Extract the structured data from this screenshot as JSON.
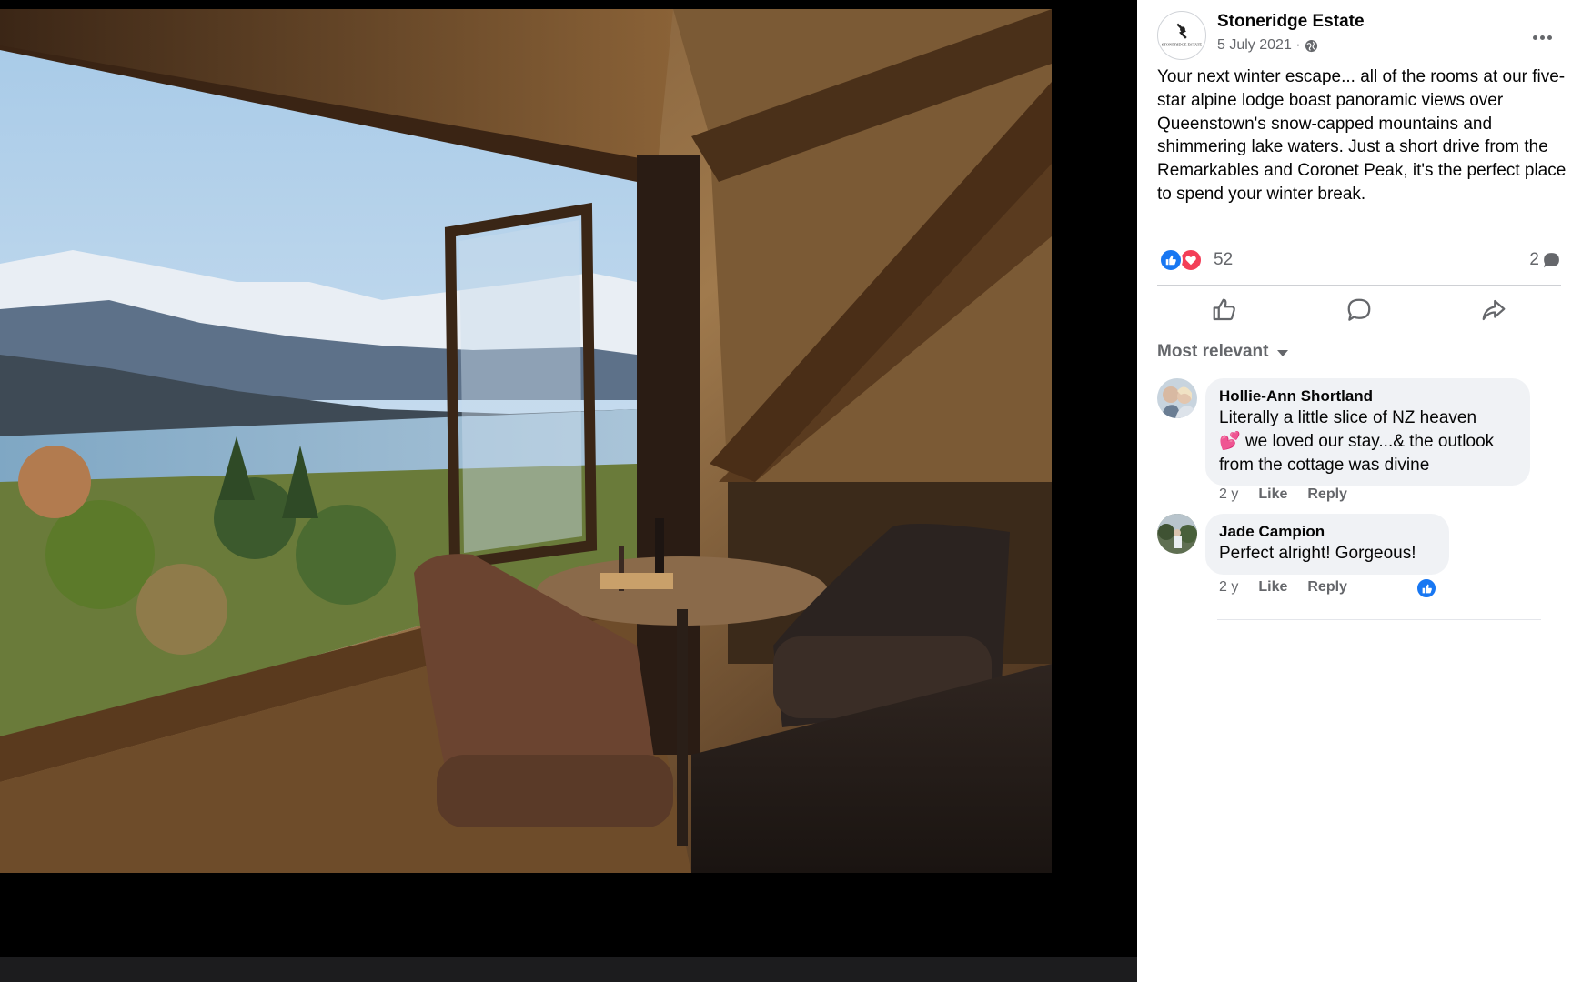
{
  "post": {
    "page_name": "Stoneridge Estate",
    "date": "5 July 2021 ·",
    "avatar_text": "STONERIDGE ESTATE",
    "text": "Your next winter escape... all of the rooms at our five-star alpine lodge boast panoramic views over Queenstown's snow-capped mountains and shimmering lake waters. Just a short drive from the Remarkables and Coronet Peak, it's the perfect place to spend your winter break.",
    "reaction_count": "52",
    "comment_count": "2",
    "reactions": [
      "like-icon",
      "love-icon"
    ]
  },
  "actions": [
    "like-icon",
    "comment-icon",
    "share-icon"
  ],
  "comments_sort": "Most relevant",
  "comments": [
    {
      "author": "Hollie-Ann Shortland",
      "text_lines": [
        "Literally a little slice of NZ heaven",
        " we loved our stay...& the outlook",
        "from the cottage was divine"
      ],
      "emoji": "💕",
      "time": "2 y",
      "like_label": "Like",
      "reply_label": "Reply"
    },
    {
      "author": "Jade Campion",
      "text": "Perfect alright! Gorgeous!",
      "time": "2 y",
      "like_label": "Like",
      "reply_label": "Reply",
      "liked": true
    }
  ],
  "colors": {
    "accent": "#1877f2",
    "love": "#f33e58",
    "secondary_text": "#65676b",
    "bubble": "#f0f2f5"
  }
}
